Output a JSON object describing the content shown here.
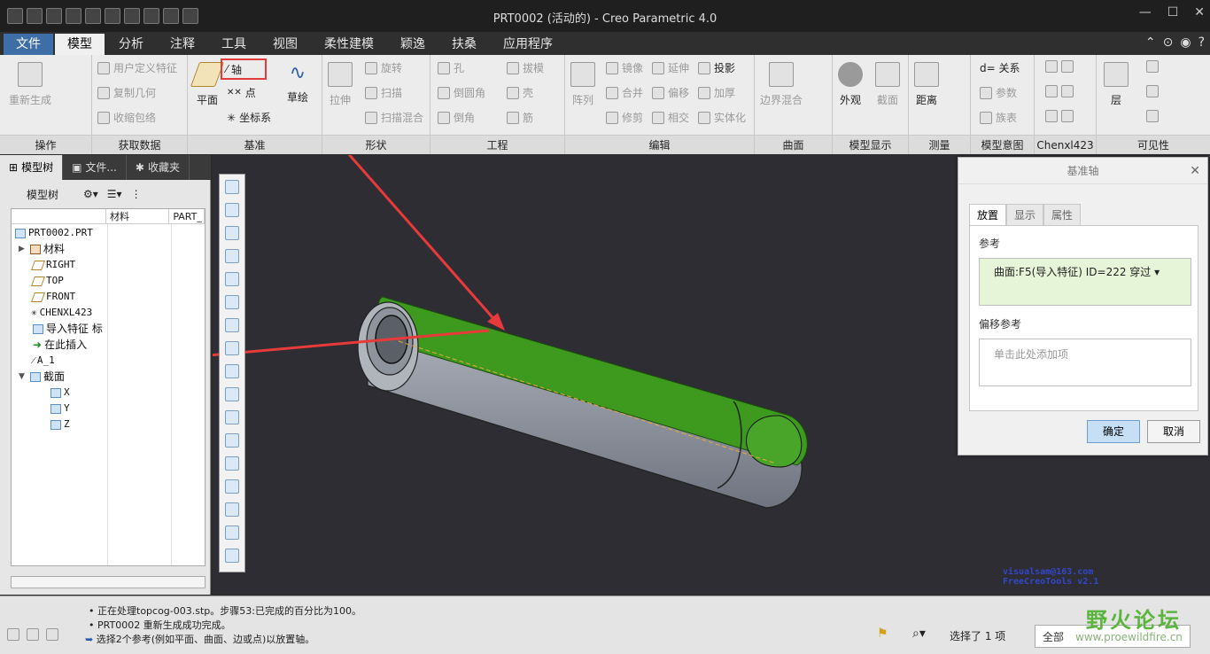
{
  "window": {
    "title": "PRT0002 (活动的) - Creo Parametric 4.0"
  },
  "tabs": [
    "文件",
    "模型",
    "分析",
    "注释",
    "工具",
    "视图",
    "柔性建模",
    "颖逸",
    "扶桑",
    "应用程序"
  ],
  "ribbon": {
    "ops": {
      "regen": "重新生成",
      "label": "操作"
    },
    "getdata": {
      "udf": "用户定义特征",
      "copygeom": "复制几何",
      "shrinkwrap": "收缩包络",
      "label": "获取数据"
    },
    "datum": {
      "plane": "平面",
      "axis": "轴",
      "point": "点",
      "csys": "坐标系",
      "sketch": "草绘",
      "label": "基准"
    },
    "shapes": {
      "extrude": "拉伸",
      "revolve": "旋转",
      "sweep": "扫描",
      "swept_blend": "扫描混合",
      "label": "形状"
    },
    "engineering": {
      "hole": "孔",
      "round": "倒圆角",
      "chamfer": "倒角",
      "draft": "拔模",
      "shell": "壳",
      "rib": "筋",
      "label": "工程"
    },
    "editing": {
      "pattern": "阵列",
      "mirror": "镜像",
      "merge": "合并",
      "trim": "修剪",
      "extend": "延伸",
      "offset": "偏移",
      "intersect": "相交",
      "project": "投影",
      "thicken": "加厚",
      "solidify": "实体化",
      "label": "编辑"
    },
    "surfaces": {
      "boundary_blend": "边界混合",
      "label": "曲面"
    },
    "model_display": {
      "appearance": "外观",
      "section": "截面",
      "label": "模型显示"
    },
    "measure": {
      "distance": "距离",
      "label": "测量"
    },
    "model_intent": {
      "relations": "d= 关系",
      "params": "参数",
      "family": "族表",
      "label": "模型意图"
    },
    "chenxl": {
      "label": "Chenxl423"
    },
    "visibility": {
      "layers": "层",
      "label": "可见性"
    }
  },
  "left_panel": {
    "tabs": [
      "模型树",
      "文件...",
      "收藏夹"
    ],
    "toolbar_label": "模型树",
    "columns": [
      "",
      "材料",
      "PART_"
    ],
    "tree": [
      {
        "label": "PRT0002.PRT"
      },
      {
        "label": "材料"
      },
      {
        "label": "RIGHT"
      },
      {
        "label": "TOP"
      },
      {
        "label": "FRONT"
      },
      {
        "label": "CHENXL423"
      },
      {
        "label": "导入特征 标"
      },
      {
        "label": "在此插入"
      },
      {
        "label": "A_1"
      },
      {
        "label": "截面"
      },
      {
        "label": "X"
      },
      {
        "label": "Y"
      },
      {
        "label": "Z"
      }
    ]
  },
  "dialog": {
    "title": "基准轴",
    "tabs": [
      "放置",
      "显示",
      "属性"
    ],
    "ref_label": "参考",
    "ref_value": "曲面:F5(导入特征) ID=222  穿过 ▾",
    "offset_label": "偏移参考",
    "offset_placeholder": "单击此处添加项",
    "ok": "确定",
    "cancel": "取消"
  },
  "status": {
    "messages": [
      "正在处理topcog-003.stp。步骤53:已完成的百分比为100。",
      "PRT0002 重新生成成功完成。",
      "选择2个参考(例如平面、曲面、边或点)以放置轴。"
    ],
    "selected": "选择了 1 项",
    "filter": "全部"
  },
  "watermark": [
    "visualsam@163.com",
    "FreeCreoTools v2.1"
  ],
  "logo": {
    "name": "野火论坛",
    "url": "www.proewildfire.cn"
  },
  "colors": {
    "accent": "#3d6ea6",
    "green_face": "#3d9a1f",
    "arrow": "#e83a3a"
  }
}
